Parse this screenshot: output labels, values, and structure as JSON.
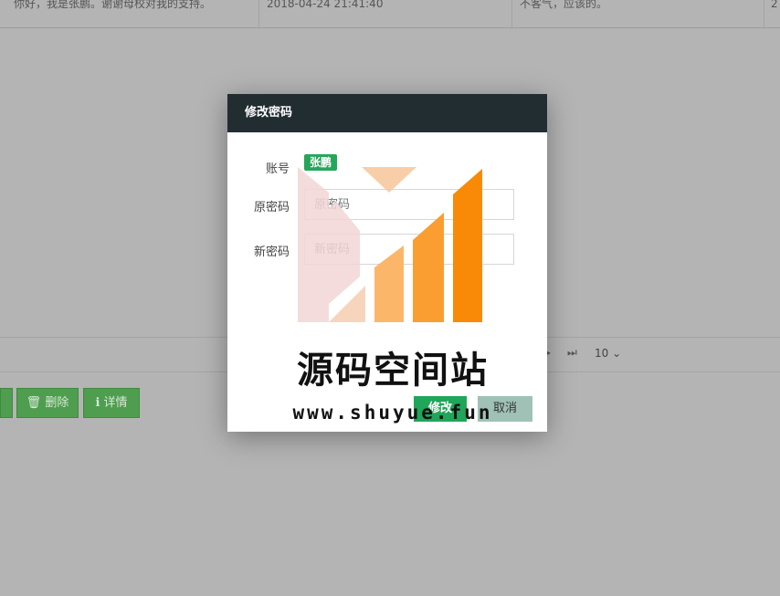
{
  "background": {
    "row": {
      "message": "你好，我是张鹏。谢谢母校对我的支持。",
      "time": "2018-04-24 21:41:40",
      "reply": "不客气，应该的。",
      "extra": "2"
    },
    "pagination": {
      "page_size": "10"
    },
    "buttons": {
      "delete_label": "删除",
      "detail_label": "详情"
    }
  },
  "modal": {
    "title": "修改密码",
    "account_label": "账号",
    "account_value": "张鹏",
    "old_password_label": "原密码",
    "old_password_placeholder": "原密码",
    "new_password_label": "新密码",
    "new_password_placeholder": "新密码",
    "submit_label": "修改",
    "cancel_label": "取消"
  },
  "watermark": {
    "title": "源码空间站",
    "url": "www.shuyue.fun"
  },
  "colors": {
    "header": "#222d32",
    "badge": "#26a65b",
    "submit": "#1fa65a",
    "cancel": "#9fc1b6"
  }
}
